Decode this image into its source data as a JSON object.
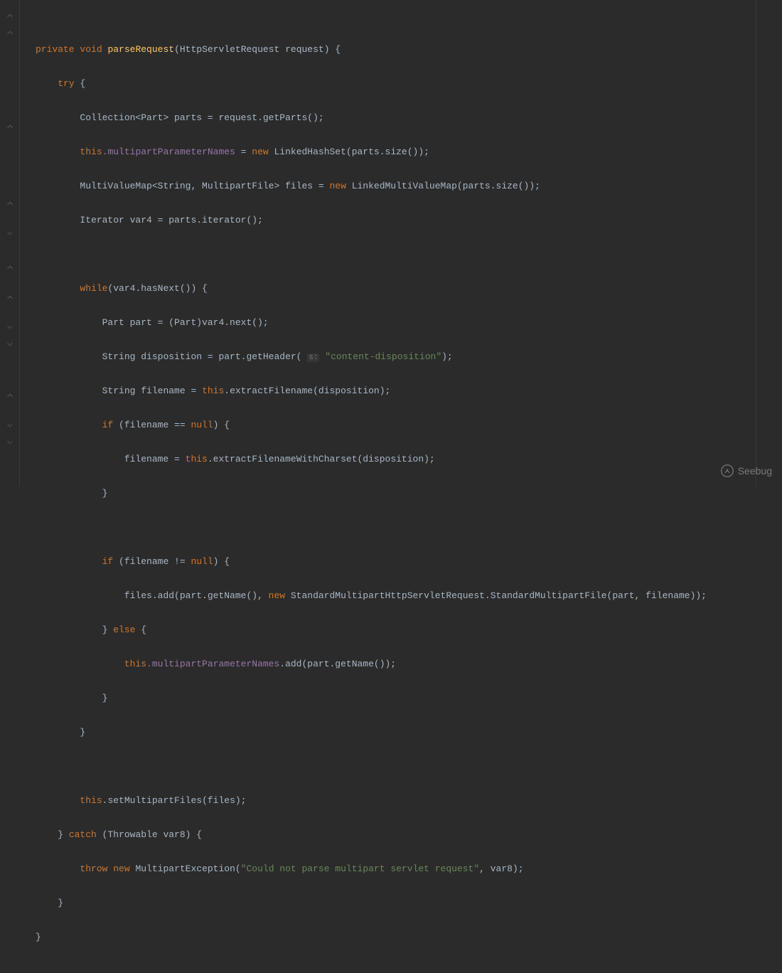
{
  "watermark": {
    "label": "Seebug"
  },
  "paramHint": "s:",
  "code": {
    "l1_private": "private",
    "l1_void": "void",
    "l1_method": "parseRequest",
    "l1_sig": "(HttpServletRequest request) {",
    "l2_try": "try",
    "l2_brace": " {",
    "l3": "Collection<Part> parts = request.getParts();",
    "l4_this": "this",
    "l4_field": ".multipartParameterNames",
    "l4_eq": " = ",
    "l4_new": "new",
    "l4_rest": " LinkedHashSet(parts.size());",
    "l5_a": "MultiValueMap<String, MultipartFile> files = ",
    "l5_new": "new",
    "l5_b": " LinkedMultiValueMap(parts.size());",
    "l6": "Iterator var4 = parts.iterator();",
    "l8_while": "while",
    "l8_rest": "(var4.hasNext()) {",
    "l9": "Part part = (Part)var4.next();",
    "l10_a": "String disposition = part.getHeader( ",
    "l10_str": "\"content-disposition\"",
    "l10_b": ");",
    "l11_a": "String filename = ",
    "l11_this": "this",
    "l11_b": ".extractFilename(disposition);",
    "l12_if": "if",
    "l12_a": " (filename == ",
    "l12_null": "null",
    "l12_b": ") {",
    "l13_a": "filename = ",
    "l13_this": "this",
    "l13_b": ".extractFilenameWithCharset(disposition);",
    "l14": "}",
    "l16_if": "if",
    "l16_a": " (filename != ",
    "l16_null": "null",
    "l16_b": ") {",
    "l17_a": "files.add(part.getName(), ",
    "l17_new": "new",
    "l17_b": " StandardMultipartHttpServletRequest.StandardMultipartFile(part, filename));",
    "l18_a": "} ",
    "l18_else": "else",
    "l18_b": " {",
    "l19_this": "this",
    "l19_field": ".multipartParameterNames",
    "l19_b": ".add(part.getName());",
    "l20": "}",
    "l21": "}",
    "l23_this": "this",
    "l23_b": ".setMultipartFiles(files);",
    "l24_a": "} ",
    "l24_catch": "catch",
    "l24_b": " (Throwable var8) {",
    "l25_throw": "throw",
    "l25_sp": " ",
    "l25_new": "new",
    "l25_a": " MultipartException(",
    "l25_str": "\"Could not parse multipart servlet request\"",
    "l25_b": ", var8);",
    "l26": "}",
    "l27": "}"
  }
}
